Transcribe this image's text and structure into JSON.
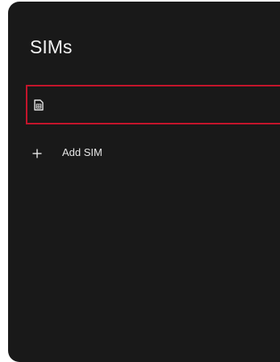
{
  "page": {
    "title": "SIMs"
  },
  "sims": [
    {
      "icon": "sim-card-icon",
      "label": ""
    }
  ],
  "add_sim": {
    "icon": "plus-icon",
    "label": "Add SIM"
  },
  "colors": {
    "panel_background": "#191919",
    "title_text": "#f2f2f2",
    "row_text": "#e6e6e6",
    "selection_outline": "#c4152b"
  }
}
